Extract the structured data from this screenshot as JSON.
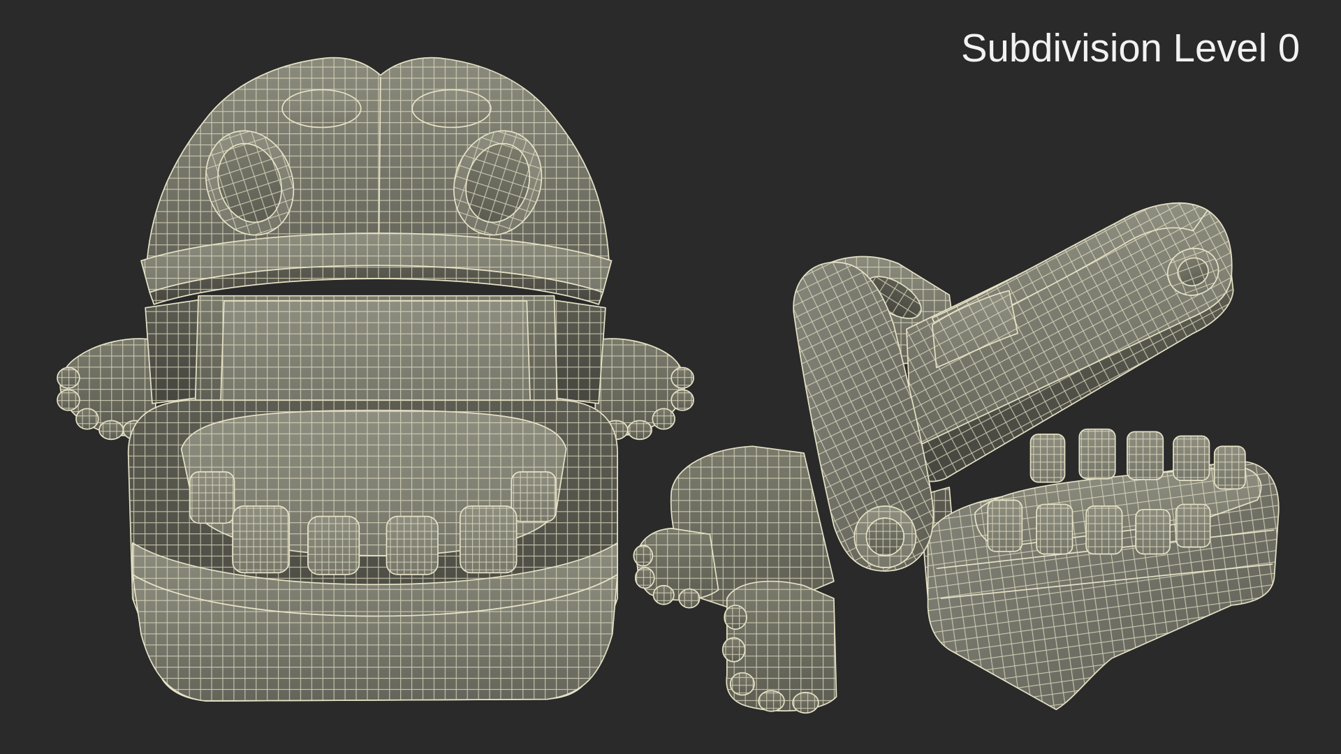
{
  "label": {
    "text": "Subdivision Level 0"
  },
  "colors": {
    "background": "#2a2a2a",
    "wireframe": "#e6e2c6",
    "label": "#f2f2f2"
  }
}
